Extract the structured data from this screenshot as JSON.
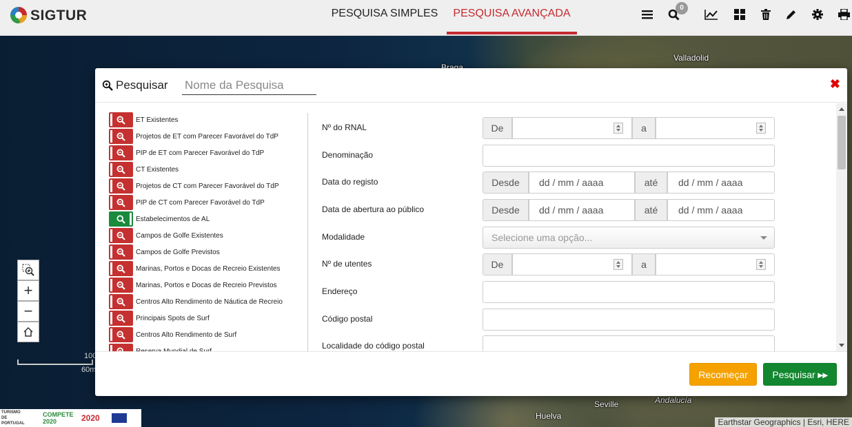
{
  "header": {
    "app_name": "SIGTUR",
    "tabs": [
      {
        "label": "PESQUISA SIMPLES"
      },
      {
        "label": "PESQUISA AVANÇADA"
      }
    ],
    "notification_count": "0",
    "icons": [
      "menu-icon",
      "search-icon",
      "chart-icon",
      "grid-icon",
      "trash-icon",
      "pencil-icon",
      "gear-icon",
      "print-icon"
    ]
  },
  "map": {
    "labels": [
      "Braga",
      "Valladolid",
      "Seville",
      "Andalucía",
      "Huelva"
    ],
    "scale_top": "100",
    "scale_bottom": "60m",
    "attribution": "Earthstar Geographics | Esri, HERE"
  },
  "footer_logos": {
    "turismo": "TURISMO DE PORTUGAL",
    "compete": "COMPETE 2020",
    "portugal2020": "2020"
  },
  "modal": {
    "title": "Pesquisar",
    "name_placeholder": "Nome da Pesquisa",
    "layers": [
      {
        "label": "ET Existentes",
        "active": false
      },
      {
        "label": "Projetos de ET com Parecer Favorável do TdP",
        "active": false
      },
      {
        "label": "PIP de ET com Parecer Favorável do TdP",
        "active": false
      },
      {
        "label": "CT Existentes",
        "active": false
      },
      {
        "label": "Projetos de CT com Parecer Favorável do TdP",
        "active": false
      },
      {
        "label": "PIP de CT com Parecer Favorável do TdP",
        "active": false
      },
      {
        "label": "Estabelecimentos de AL",
        "active": true
      },
      {
        "label": "Campos de Golfe Existentes",
        "active": false
      },
      {
        "label": "Campos de Golfe Previstos",
        "active": false
      },
      {
        "label": "Marinas, Portos e Docas de Recreio Existentes",
        "active": false
      },
      {
        "label": "Marinas, Portos e Docas de Recreio Previstos",
        "active": false
      },
      {
        "label": "Centros Alto Rendimento de Náutica de Recreio",
        "active": false
      },
      {
        "label": "Principais Spots de Surf",
        "active": false
      },
      {
        "label": "Centros Alto Rendimento de Surf",
        "active": false
      },
      {
        "label": "Reserva Mundial de Surf",
        "active": false
      }
    ],
    "fields": {
      "rnal": {
        "label": "Nº do RNAL",
        "from": "De",
        "to": "a"
      },
      "denominacao": {
        "label": "Denominação"
      },
      "data_registo": {
        "label": "Data do registo",
        "from": "Desde",
        "to": "até",
        "placeholder": "dd / mm / aaaa"
      },
      "data_abertura": {
        "label": "Data de abertura ao público",
        "from": "Desde",
        "to": "até",
        "placeholder": "dd / mm / aaaa"
      },
      "modalidade": {
        "label": "Modalidade",
        "placeholder": "Selecione uma opção..."
      },
      "utentes": {
        "label": "Nº de utentes",
        "from": "De",
        "to": "a"
      },
      "endereco": {
        "label": "Endereço"
      },
      "codigo_postal": {
        "label": "Código postal"
      },
      "localidade": {
        "label": "Localidade do código postal"
      }
    },
    "buttons": {
      "reset": "Recomeçar",
      "search": "Pesquisar"
    }
  }
}
